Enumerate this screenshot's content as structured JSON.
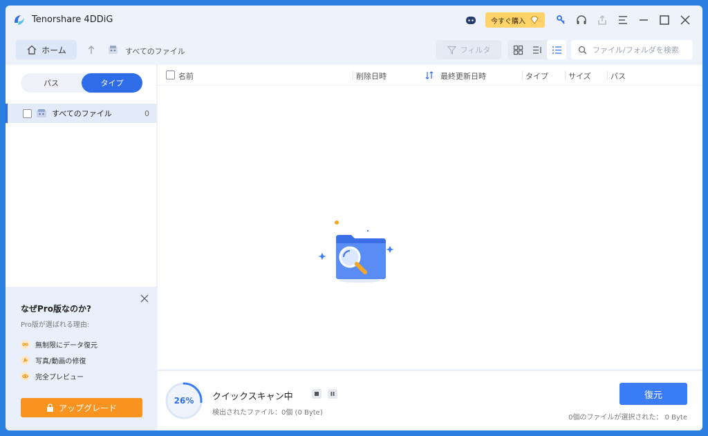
{
  "app": {
    "title": "Tenorshare 4DDiG"
  },
  "titlebar": {
    "buy_label": "今すぐ購入",
    "icons": [
      "assistant-icon",
      "key-icon",
      "headset-icon",
      "share-icon",
      "menu-icon",
      "minimize-icon",
      "maximize-icon",
      "close-icon"
    ]
  },
  "toolbar": {
    "home_label": "ホーム",
    "breadcrumb": "すべてのファイル",
    "filter_label": "フィルタ",
    "search_placeholder": "ファイル/フォルダを検索"
  },
  "sidebar": {
    "tabs": [
      {
        "label": "パス",
        "active": false
      },
      {
        "label": "タイプ",
        "active": true
      }
    ],
    "items": [
      {
        "label": "すべてのファイル",
        "count": "0"
      }
    ]
  },
  "table": {
    "columns": [
      "名前",
      "削除日時",
      "最終更新日時",
      "タイプ",
      "サイズ",
      "パス"
    ]
  },
  "promo": {
    "title": "なぜPro版なのか?",
    "subtitle": "Pro版が選ばれる理由:",
    "features": [
      "無制限にデータ復元",
      "写真/動画の修復",
      "完全プレビュー"
    ],
    "upgrade_label": "アップグレード"
  },
  "scan": {
    "progress_percent": 26,
    "progress_label": "26%",
    "title": "クイックスキャン中",
    "detected": "検出されたファイル：0個 (0 Byte)"
  },
  "footer": {
    "restore_label": "復元",
    "selected_info": "0個のファイルが選択された：  0 Byte"
  },
  "colors": {
    "accent": "#2f6de8",
    "upgrade": "#f7931e",
    "buy": "#ffd36a"
  }
}
